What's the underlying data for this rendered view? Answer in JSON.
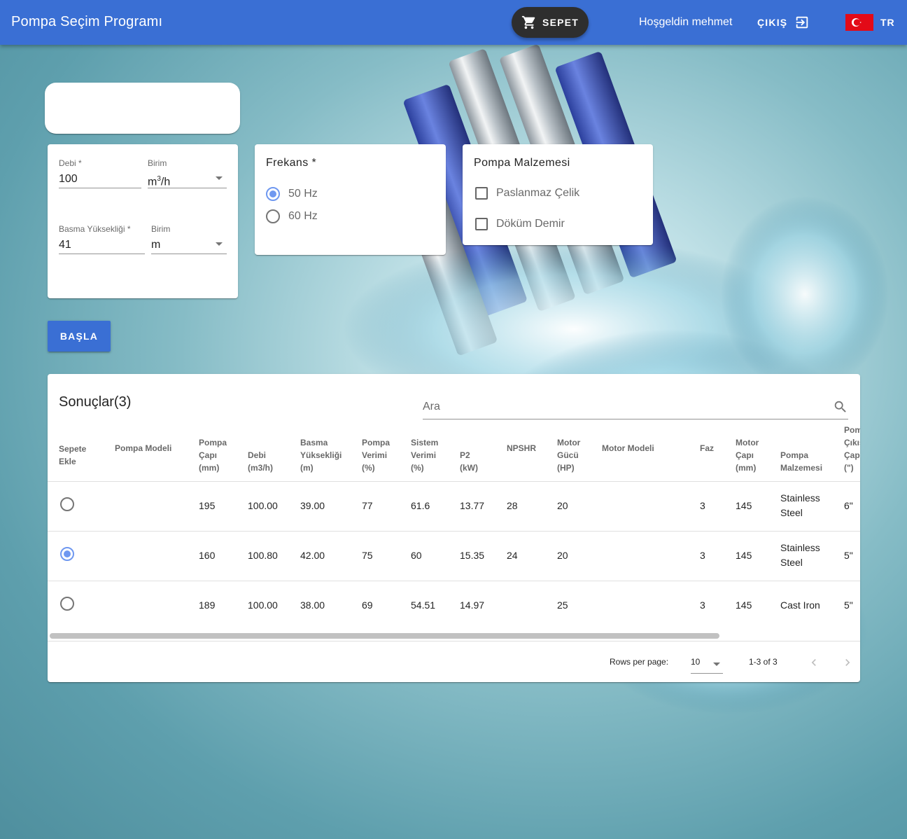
{
  "appbar": {
    "title": "Pompa Seçim Programı",
    "cart_label": "SEPET",
    "welcome": "Hoşgeldin mehmet",
    "logout_label": "ÇIKIŞ",
    "lang": "TR"
  },
  "inputs": {
    "flow_label": "Debi *",
    "flow_value": "100",
    "flow_unit_label": "Birim",
    "flow_unit_base": "m",
    "flow_unit_sup": "3",
    "flow_unit_tail": "/h",
    "head_label": "Basma Yüksekliği *",
    "head_value": "41",
    "head_unit_label": "Birim",
    "head_unit_value": "m"
  },
  "frequency": {
    "title": "Frekans *",
    "options": [
      {
        "label": "50 Hz",
        "selected": true
      },
      {
        "label": "60 Hz",
        "selected": false
      }
    ]
  },
  "material": {
    "title": "Pompa Malzemesi",
    "options": [
      {
        "label": "Paslanmaz Çelik",
        "checked": false
      },
      {
        "label": "Döküm Demir",
        "checked": false
      }
    ]
  },
  "start_label": "BAŞLA",
  "results": {
    "title": "Sonuçlar(3)",
    "search_placeholder": "Ara",
    "columns": [
      [
        "Sepete",
        "Ekle"
      ],
      [
        "Pompa Modeli"
      ],
      [
        "Pompa",
        "Çapı",
        "(mm)"
      ],
      [
        "Debi",
        "(m3/h)"
      ],
      [
        "Basma",
        "Yüksekliği",
        "(m)"
      ],
      [
        "Pompa",
        "Verimi",
        "(%)"
      ],
      [
        "Sistem",
        "Verimi",
        "(%)"
      ],
      [
        "P2",
        "(kW)"
      ],
      [
        "NPSHR"
      ],
      [
        "Motor",
        "Gücü",
        "(HP)"
      ],
      [
        "Motor Modeli"
      ],
      [
        "Faz"
      ],
      [
        "Motor",
        "Çapı",
        "(mm)"
      ],
      [
        "Pompa",
        "Malzemesi"
      ],
      [
        "Pompa",
        "Çıkış",
        "Çapı",
        "(\")"
      ]
    ],
    "rows": [
      {
        "selected": false,
        "cells": [
          "",
          "195",
          "100.00",
          "39.00",
          "77",
          "61.6",
          "13.77",
          "28",
          "20",
          "",
          "3",
          "145",
          "Stainless Steel",
          "6\""
        ]
      },
      {
        "selected": true,
        "cells": [
          "",
          "160",
          "100.80",
          "42.00",
          "75",
          "60",
          "15.35",
          "24",
          "20",
          "",
          "3",
          "145",
          "Stainless Steel",
          "5\""
        ]
      },
      {
        "selected": false,
        "cells": [
          "",
          "189",
          "100.00",
          "38.00",
          "69",
          "54.51",
          "14.97",
          "",
          "25",
          "",
          "3",
          "145",
          "Cast Iron",
          "5\""
        ]
      }
    ],
    "rows_per_page_label": "Rows per page:",
    "rows_per_page": "10",
    "range": "1-3 of 3"
  }
}
